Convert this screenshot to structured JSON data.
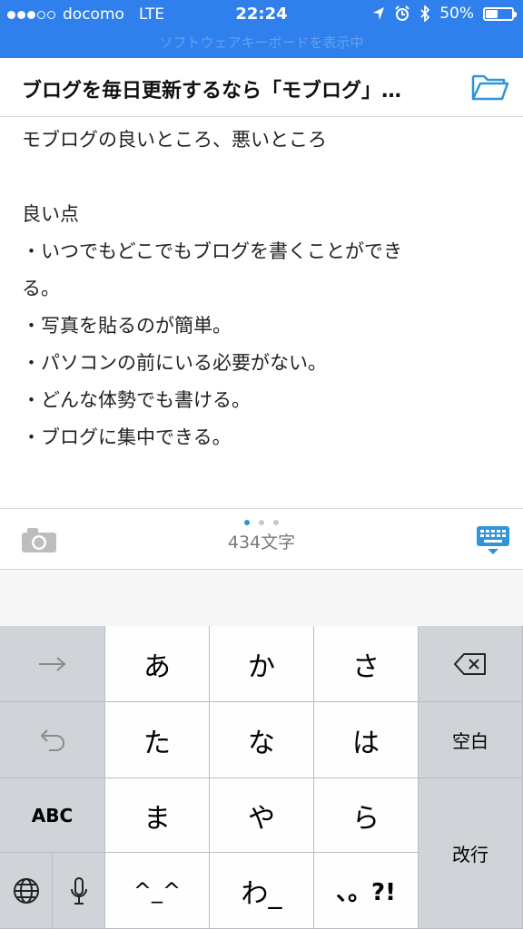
{
  "status_bar": {
    "carrier": "docomo",
    "network": "LTE",
    "time": "22:24",
    "battery": "50%",
    "battery_level": 0.5,
    "subtitle": "ソフトウェアキーボードを表示中"
  },
  "document": {
    "title": "ブログを毎日更新するなら「モブログ」…",
    "lines": [
      "モブログの良いところ、悪いところ",
      "",
      "良い点",
      "・いつでもどこでもブログを書くことができ",
      "る。",
      "・写真を貼るのが簡単。",
      "・パソコンの前にいる必要がない。",
      "・どんな体勢でも書ける。",
      "・ブログに集中できる。"
    ]
  },
  "toolbar": {
    "char_count": "434文字",
    "page_index": 1,
    "page_total": 3
  },
  "keyboard": {
    "kana": [
      "あ",
      "か",
      "さ",
      "た",
      "な",
      "は",
      "ま",
      "や",
      "ら",
      "^_^",
      "わ_",
      "、。?!"
    ],
    "abc": "ABC",
    "space": "空白",
    "return": "改行"
  },
  "colors": {
    "accent": "#2f80ec",
    "icon_blue": "#2f95d8",
    "key_bg": "#fefefe",
    "side_key_bg": "#d0d3d8"
  },
  "icons": [
    "location-icon",
    "alarm-icon",
    "bluetooth-icon",
    "folder-icon",
    "camera-icon",
    "keyboard-hide-icon",
    "arrow-right-icon",
    "undo-icon",
    "delete-icon",
    "globe-icon",
    "microphone-icon"
  ]
}
